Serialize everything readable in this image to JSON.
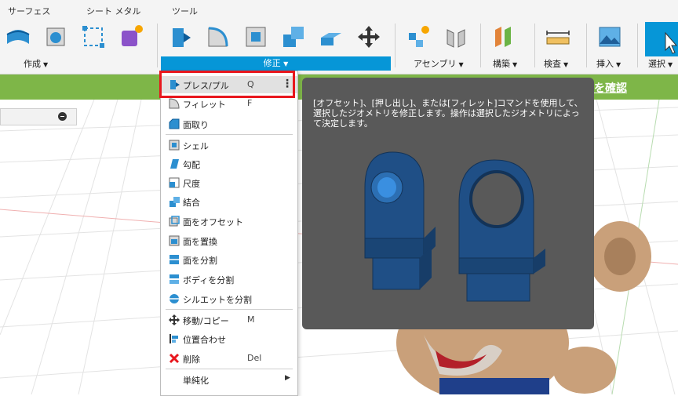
{
  "tabs": [
    "サーフェス",
    "シート メタル",
    "ツール"
  ],
  "groups": {
    "create": "作成",
    "modify": "修正",
    "assemble": "アセンブリ",
    "construct": "構築",
    "inspect": "検査",
    "insert": "挿入",
    "select": "選択"
  },
  "banner_link": "を確認",
  "menu": {
    "items": [
      {
        "label": "プレス/プル",
        "shortcut": "Q",
        "icon": "press-pull-icon"
      },
      {
        "label": "フィレット",
        "shortcut": "F",
        "icon": "fillet-icon"
      },
      {
        "label": "面取り",
        "shortcut": "",
        "icon": "chamfer-icon"
      },
      {
        "label": "シェル",
        "shortcut": "",
        "icon": "shell-icon"
      },
      {
        "label": "勾配",
        "shortcut": "",
        "icon": "draft-icon"
      },
      {
        "label": "尺度",
        "shortcut": "",
        "icon": "scale-icon"
      },
      {
        "label": "結合",
        "shortcut": "",
        "icon": "combine-icon"
      },
      {
        "label": "面をオフセット",
        "shortcut": "",
        "icon": "offset-face-icon"
      },
      {
        "label": "面を置換",
        "shortcut": "",
        "icon": "replace-face-icon"
      },
      {
        "label": "面を分割",
        "shortcut": "",
        "icon": "split-face-icon"
      },
      {
        "label": "ボディを分割",
        "shortcut": "",
        "icon": "split-body-icon"
      },
      {
        "label": "シルエットを分割",
        "shortcut": "",
        "icon": "silhouette-split-icon"
      },
      {
        "label": "移動/コピー",
        "shortcut": "M",
        "icon": "move-icon"
      },
      {
        "label": "位置合わせ",
        "shortcut": "",
        "icon": "align-icon"
      },
      {
        "label": "削除",
        "shortcut": "Del",
        "icon": "delete-icon"
      },
      {
        "label": "単純化",
        "shortcut": "",
        "icon": "simplify-icon"
      }
    ]
  },
  "tooltip": {
    "text": "[オフセット]、[押し出し]、または[フィレット]コマンドを使用して、選択したジオメトリを修正します。操作は選択したジオメトリによって決定します。"
  },
  "colors": {
    "accent": "#0696d7",
    "highlight_box": "#e8161d",
    "banner": "#7eb648",
    "tooltip_bg": "#595959",
    "model_blue": "#1f4f86"
  }
}
